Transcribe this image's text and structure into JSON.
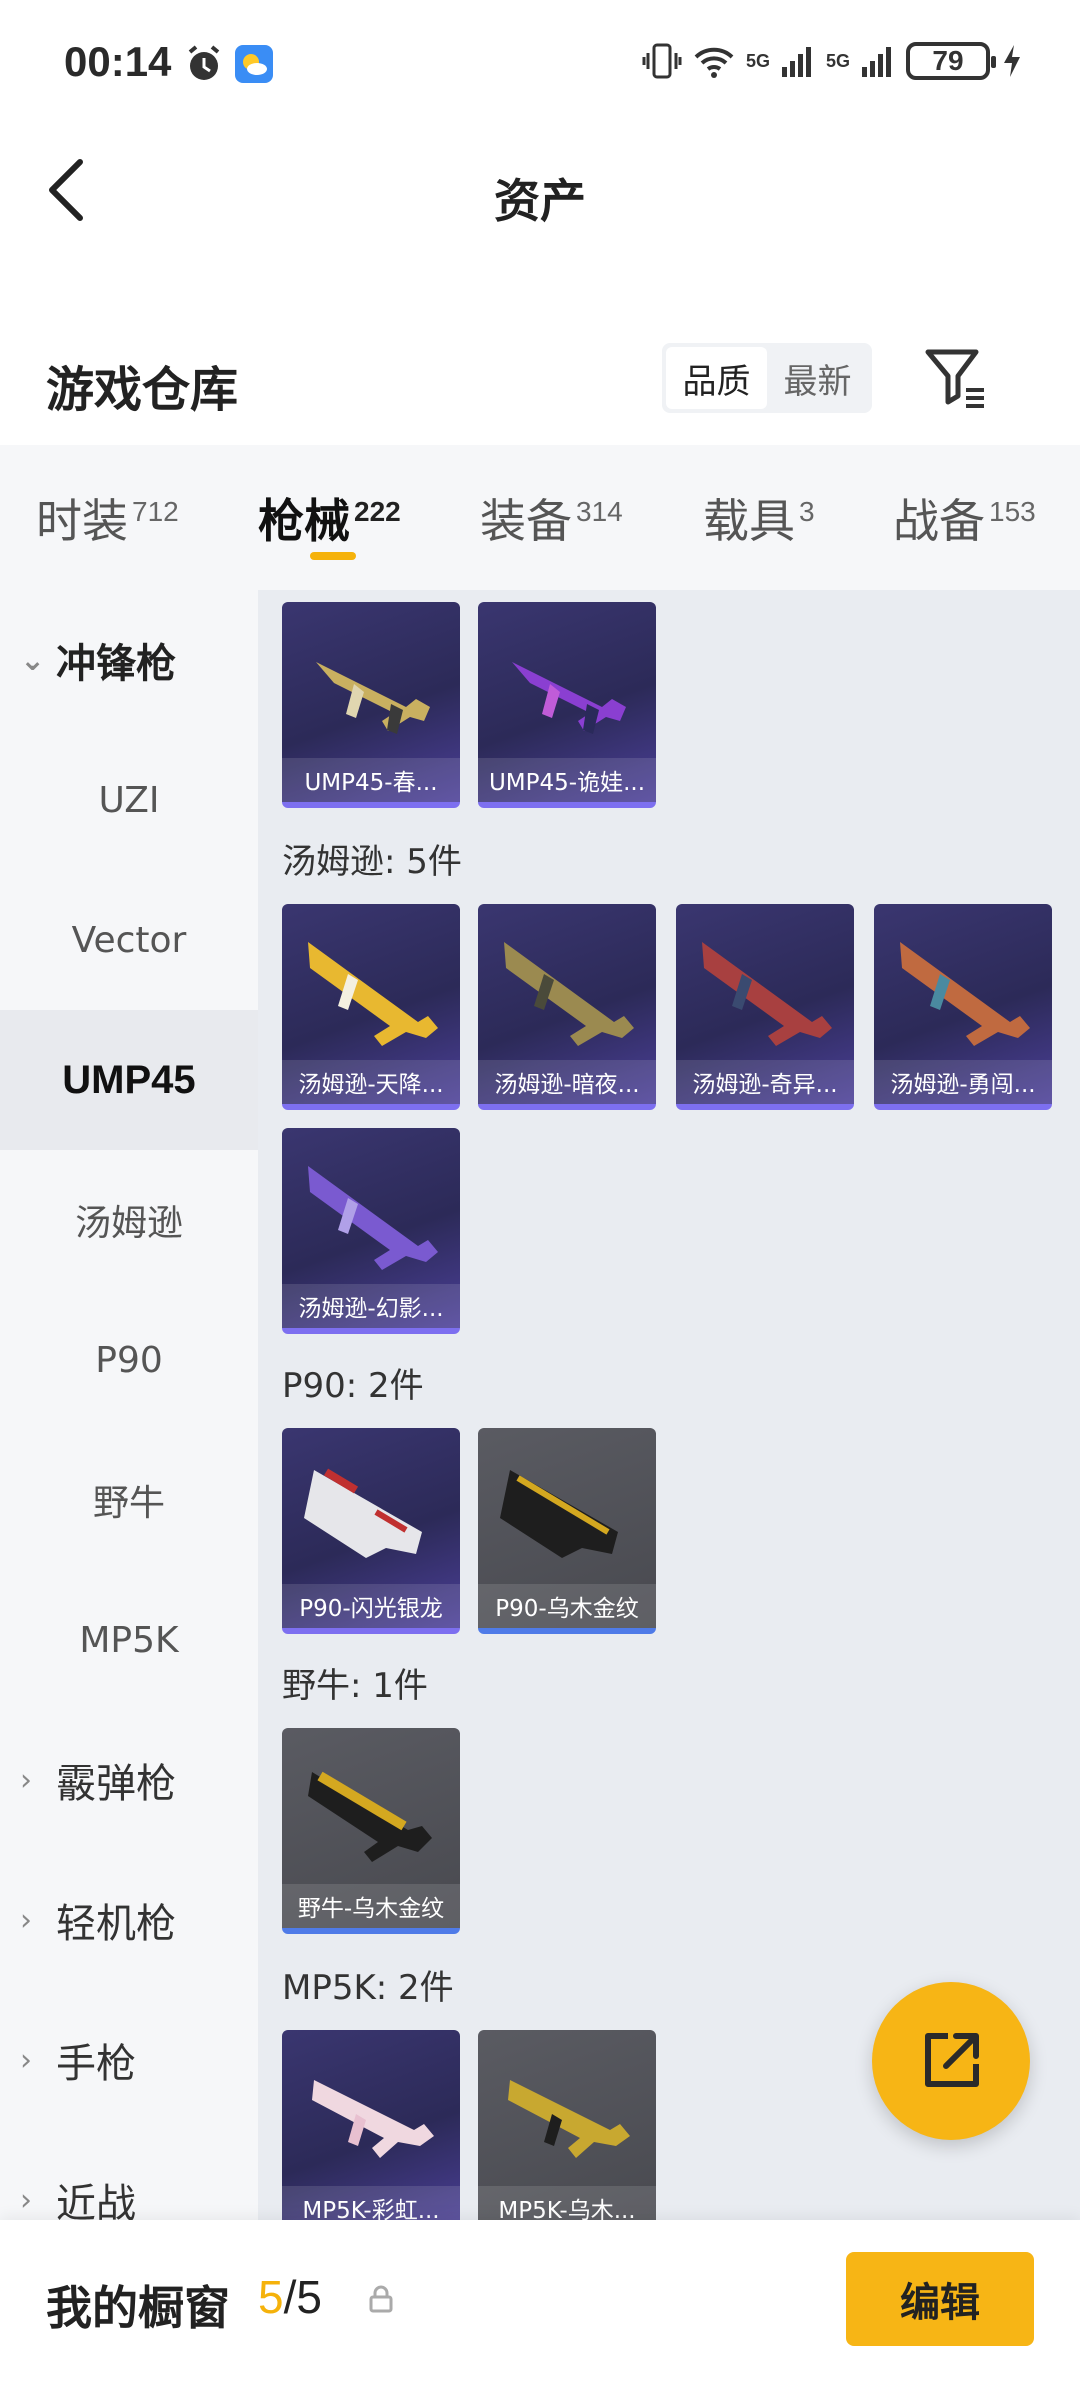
{
  "status_bar": {
    "time": "00:14",
    "battery": "79",
    "network_1": "5G",
    "network_2": "5G"
  },
  "nav": {
    "title": "资产"
  },
  "warehouse": {
    "title": "游戏仓库",
    "sort_options": [
      "品质",
      "最新"
    ],
    "active_sort": "品质"
  },
  "tabs": [
    {
      "label": "时装",
      "count": "712"
    },
    {
      "label": "枪械",
      "count": "222"
    },
    {
      "label": "装备",
      "count": "314"
    },
    {
      "label": "载具",
      "count": "3"
    },
    {
      "label": "战备",
      "count": "153"
    }
  ],
  "active_tab": "枪械",
  "sidebar": {
    "groups": [
      {
        "label": "冲锋枪",
        "expanded": true
      },
      {
        "label": "霰弹枪",
        "expanded": false
      },
      {
        "label": "轻机枪",
        "expanded": false
      },
      {
        "label": "手枪",
        "expanded": false
      },
      {
        "label": "近战",
        "expanded": false
      }
    ],
    "items": [
      "UZI",
      "Vector",
      "UMP45",
      "汤姆逊",
      "P90",
      "野牛",
      "MP5K"
    ],
    "active_item": "UMP45"
  },
  "content": {
    "sections": [
      {
        "label": "",
        "items": [
          "UMP45-春...",
          "UMP45-诡娃..."
        ]
      },
      {
        "label": "汤姆逊: 5件",
        "items": [
          "汤姆逊-天降...",
          "汤姆逊-暗夜...",
          "汤姆逊-奇异...",
          "汤姆逊-勇闯...",
          "汤姆逊-幻影..."
        ]
      },
      {
        "label": "P90: 2件",
        "items": [
          "P90-闪光银龙",
          "P90-乌木金纹"
        ]
      },
      {
        "label": "野牛: 1件",
        "items": [
          "野牛-乌木金纹"
        ]
      },
      {
        "label": "MP5K: 2件",
        "items": [
          "MP5K-彩虹...",
          "MP5K-乌木..."
        ]
      }
    ]
  },
  "bottom_bar": {
    "label": "我的橱窗",
    "current": "5",
    "total": "/5",
    "edit_label": "编辑"
  },
  "colors": {
    "accent": "#f7b515",
    "purple_card": "#2c2a58",
    "gray_card": "#48494f"
  }
}
